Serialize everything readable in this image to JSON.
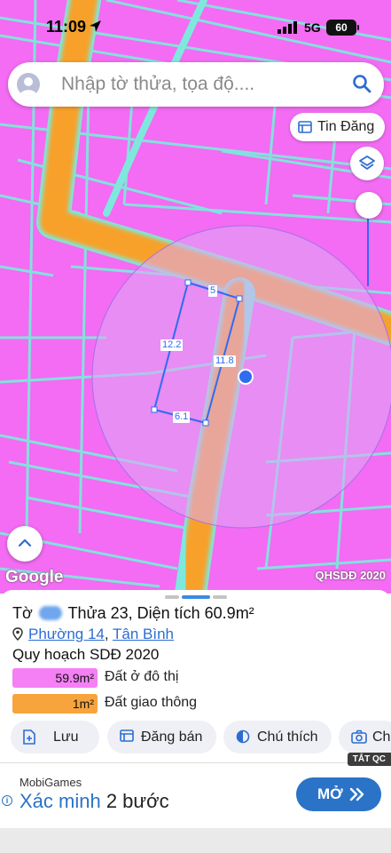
{
  "status_bar": {
    "time": "11:09",
    "network": "5G",
    "battery": "60"
  },
  "search": {
    "placeholder": "Nhập tờ thửa, tọa độ...."
  },
  "tin_dang_label": "Tin Đăng",
  "map": {
    "google_logo": "Google",
    "layer_label": "QHSDĐ 2020",
    "edge_lengths": [
      "5",
      "12.2",
      "11.8",
      "6.1"
    ],
    "colors": {
      "residential": "#f36cf3",
      "road": "#f7a12c",
      "parcel_line": "#7ee8dc",
      "selection": "#2f6bf3"
    }
  },
  "parcel": {
    "to_prefix": "Tờ",
    "thua_label": "Thửa 23",
    "area_label": "Diện tích 60.9m²",
    "ward": "Phường 14",
    "district": "Tân Bình",
    "plan_title": "Quy hoạch SDĐ 2020",
    "legend": [
      {
        "value": "59.9m²",
        "label": "Đất ở đô thị",
        "color": "#f57ff5"
      },
      {
        "value": "1m²",
        "label": "Đất giao thông",
        "color": "#f7a43c"
      }
    ]
  },
  "actions": [
    "Lưu",
    "Đăng bán",
    "Chú thích",
    "Ch"
  ],
  "ad": {
    "badge": "TẮT QC",
    "source": "MobiGames",
    "headline_highlight": "Xác minh",
    "headline_rest": " 2 bước",
    "cta": "MỞ",
    "info": "i"
  }
}
